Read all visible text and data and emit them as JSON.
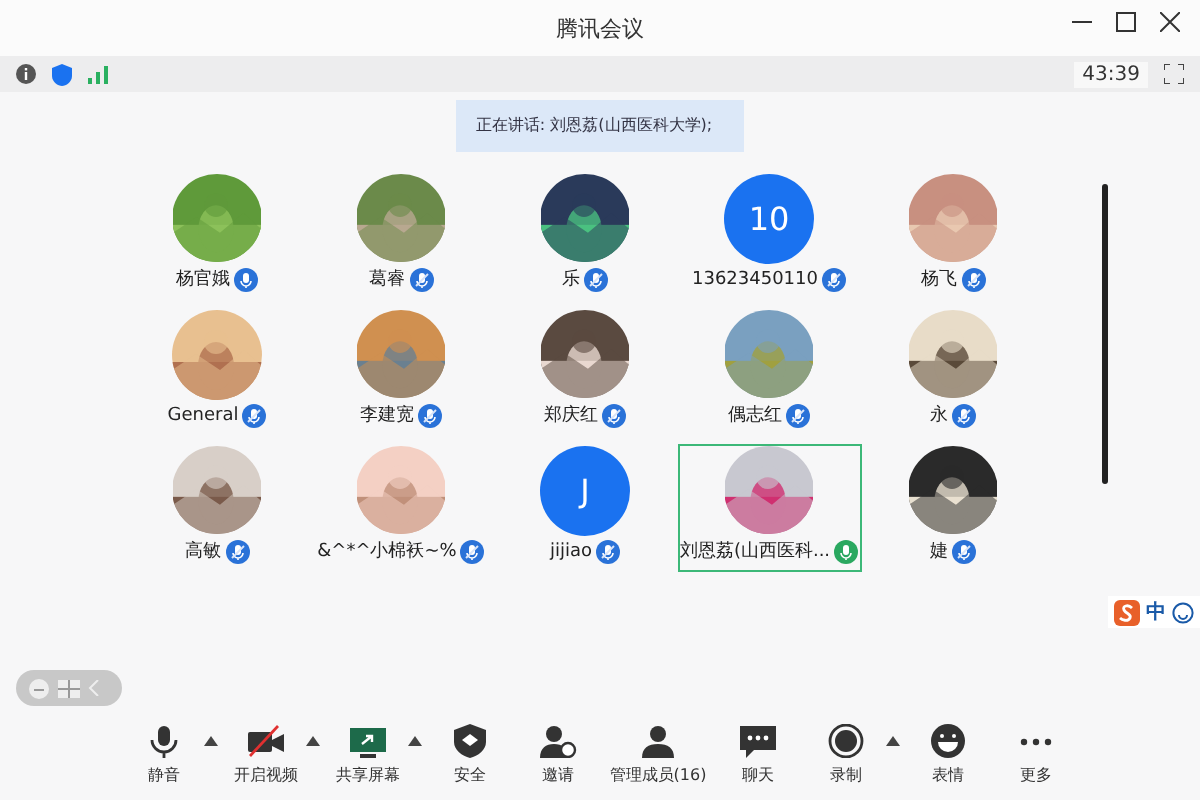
{
  "window": {
    "title": "腾讯会议"
  },
  "info_bar": {
    "timer": "43:39"
  },
  "speaking_banner": "正在讲话: 刘恩荔(山西医科大学);",
  "participants": [
    {
      "name": "杨官娥",
      "kind": "picture",
      "muted": false,
      "speaking": false,
      "highlighted": false
    },
    {
      "name": "葛睿",
      "kind": "picture",
      "muted": true,
      "speaking": false,
      "highlighted": false
    },
    {
      "name": "乐",
      "kind": "picture",
      "muted": true,
      "speaking": false,
      "highlighted": false
    },
    {
      "name": "13623450110",
      "kind": "initial",
      "initial": "10",
      "muted": true,
      "speaking": false,
      "highlighted": false
    },
    {
      "name": "杨飞",
      "kind": "picture",
      "muted": true,
      "speaking": false,
      "highlighted": false
    },
    {
      "name": "General",
      "kind": "picture",
      "muted": true,
      "speaking": false,
      "highlighted": false
    },
    {
      "name": "李建宽",
      "kind": "picture",
      "muted": true,
      "speaking": false,
      "highlighted": false
    },
    {
      "name": "郑庆红",
      "kind": "picture",
      "muted": true,
      "speaking": false,
      "highlighted": false
    },
    {
      "name": "偶志红",
      "kind": "picture",
      "muted": true,
      "speaking": false,
      "highlighted": false
    },
    {
      "name": "永",
      "kind": "picture",
      "muted": true,
      "speaking": false,
      "highlighted": false
    },
    {
      "name": "高敏",
      "kind": "picture",
      "muted": true,
      "speaking": false,
      "highlighted": false
    },
    {
      "name": "&^*^小棉袄~%",
      "kind": "picture",
      "muted": true,
      "speaking": false,
      "highlighted": false
    },
    {
      "name": "jijiao",
      "kind": "initial",
      "initial": "J",
      "muted": true,
      "speaking": false,
      "highlighted": false
    },
    {
      "name": "刘恩荔(山西医科...",
      "kind": "picture",
      "muted": false,
      "speaking": true,
      "highlighted": true
    },
    {
      "name": "婕",
      "kind": "picture",
      "muted": true,
      "speaking": false,
      "highlighted": false
    }
  ],
  "ime_bar": {
    "mode": "中"
  },
  "toolbar": [
    {
      "label": "静音",
      "kind": "mic",
      "caret": true
    },
    {
      "label": "开启视频",
      "kind": "video",
      "caret": true
    },
    {
      "label": "共享屏幕",
      "kind": "share",
      "caret": true
    },
    {
      "label": "安全",
      "kind": "shield",
      "caret": false
    },
    {
      "label": "邀请",
      "kind": "invite",
      "caret": false
    },
    {
      "label": "管理成员(16)",
      "kind": "members",
      "caret": false
    },
    {
      "label": "聊天",
      "kind": "chat",
      "caret": false
    },
    {
      "label": "录制",
      "kind": "record",
      "caret": true
    },
    {
      "label": "表情",
      "kind": "emoji",
      "caret": false
    },
    {
      "label": "更多",
      "kind": "more",
      "caret": false
    }
  ]
}
